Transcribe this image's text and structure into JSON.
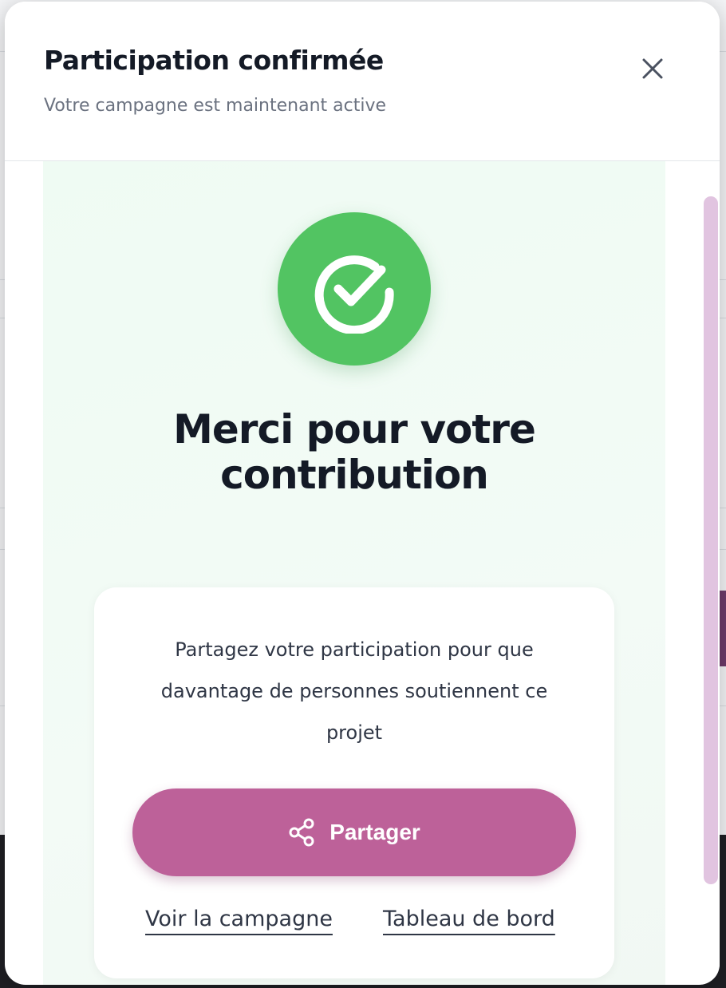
{
  "modal": {
    "title": "Participation confirmée",
    "subtitle": "Votre campagne est maintenant active",
    "close_icon": "close-icon"
  },
  "success": {
    "icon": "check-circle-icon",
    "heading_line1": "Merci pour votre",
    "heading_line2": "contribution"
  },
  "share_card": {
    "text": "Partagez votre participation pour que davantage de personnes soutiennent ce projet",
    "share_button_label": "Partager",
    "share_icon": "share-icon",
    "link_campaign": "Voir la campagne",
    "link_dashboard": "Tableau de bord"
  },
  "colors": {
    "success_green": "#52c462",
    "share_button": "#bd6199",
    "panel_bg": "#effbf3",
    "scrollbar_thumb": "#e1c4e0"
  }
}
